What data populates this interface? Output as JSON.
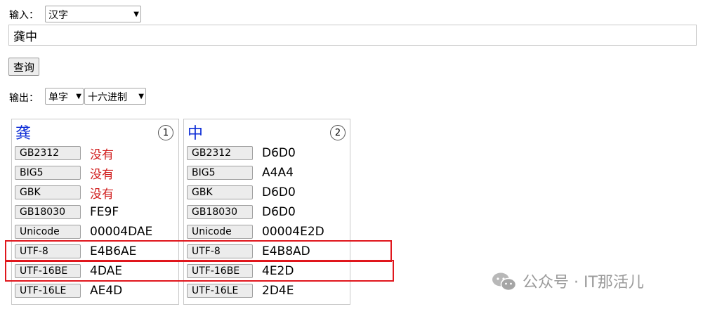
{
  "input": {
    "label": "输入：",
    "type_select": "汉字",
    "text_value": "龚中",
    "query_button": "查询"
  },
  "output": {
    "label": "输出：",
    "mode_select": "单字",
    "base_select": "十六进制"
  },
  "results": [
    {
      "char": "龚",
      "index": "1",
      "rows": [
        {
          "label": "GB2312",
          "value": "没有",
          "missing": true
        },
        {
          "label": "BIG5",
          "value": "没有",
          "missing": true
        },
        {
          "label": "GBK",
          "value": "没有",
          "missing": true
        },
        {
          "label": "GB18030",
          "value": "FE9F",
          "missing": false
        },
        {
          "label": "Unicode",
          "value": "00004DAE",
          "missing": false
        },
        {
          "label": "UTF-8",
          "value": "E4B6AE",
          "missing": false
        },
        {
          "label": "UTF-16BE",
          "value": "4DAE",
          "missing": false
        },
        {
          "label": "UTF-16LE",
          "value": "AE4D",
          "missing": false
        }
      ]
    },
    {
      "char": "中",
      "index": "2",
      "rows": [
        {
          "label": "GB2312",
          "value": "D6D0",
          "missing": false
        },
        {
          "label": "BIG5",
          "value": "A4A4",
          "missing": false
        },
        {
          "label": "GBK",
          "value": "D6D0",
          "missing": false
        },
        {
          "label": "GB18030",
          "value": "D6D0",
          "missing": false
        },
        {
          "label": "Unicode",
          "value": "00004E2D",
          "missing": false
        },
        {
          "label": "UTF-8",
          "value": "E4B8AD",
          "missing": false
        },
        {
          "label": "UTF-16BE",
          "value": "4E2D",
          "missing": false
        },
        {
          "label": "UTF-16LE",
          "value": "2D4E",
          "missing": false
        }
      ]
    }
  ],
  "watermark": "公众号 · IT那活儿",
  "colors": {
    "char_blue": "#0b2bd6",
    "missing_red": "#d01c1c",
    "highlight_red": "#e0171d"
  }
}
